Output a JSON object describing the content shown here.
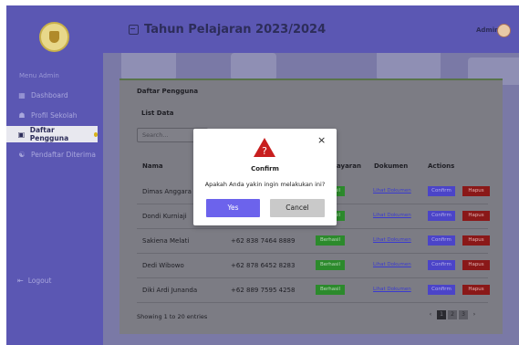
{
  "sidebar": {
    "menu_title": "Menu Admin",
    "items": [
      {
        "icon": "dashboard-icon",
        "label": "Dashboard"
      },
      {
        "icon": "school-icon",
        "label": "Profil Sekolah"
      },
      {
        "icon": "user-list-icon",
        "label": "Daftar Pengguna"
      },
      {
        "icon": "users-accepted-icon",
        "label": "Pendaftar Diterima"
      }
    ],
    "logout": "Logout"
  },
  "header": {
    "title": "Tahun Pelajaran 2023/2024",
    "admin": "Admin"
  },
  "card": {
    "title": "Daftar Pengguna",
    "list_label": "List Data",
    "search_placeholder": "Search...",
    "columns": [
      "Nama",
      "",
      "Pembayaran",
      "Dokumen",
      "Actions"
    ],
    "column_visible": [
      "Nama",
      "ayaran",
      "Dokumen",
      "Actions"
    ],
    "rows": [
      {
        "name": "Dimas Anggara",
        "phone": "",
        "status": "Berhasil",
        "doc": "Lihat Dokumen",
        "confirm": "Confirm",
        "delete": "Hapus"
      },
      {
        "name": "Dondi Kurniaji",
        "phone": "",
        "status": "Berhasil",
        "doc": "Lihat Dokumen",
        "confirm": "Confirm",
        "delete": "Hapus"
      },
      {
        "name": "Sakiena Melati",
        "phone": "+62 838 7464 8889",
        "status": "Berhasil",
        "doc": "Lihat Dokumen",
        "confirm": "Confirm",
        "delete": "Hapus"
      },
      {
        "name": "Dedi Wibowo",
        "phone": "+62 878 6452 8283",
        "status": "Berhasil",
        "doc": "Lihat Dokumen",
        "confirm": "Confirm",
        "delete": "Hapus"
      },
      {
        "name": "Diki Ardi Junanda",
        "phone": "+62 889 7595 4258",
        "status": "Berhasil",
        "doc": "Lihat Dokumen",
        "confirm": "Confirm",
        "delete": "Hapus"
      }
    ],
    "footer": "Showing 1 to 20 entries",
    "pager": {
      "prev": "‹",
      "pages": [
        "1",
        "2",
        "3"
      ],
      "next": "›"
    }
  },
  "modal": {
    "title": "Confirm",
    "message": "Apakah Anda yakin ingin melakukan ini?",
    "yes": "Yes",
    "cancel": "Cancel",
    "close": "×"
  },
  "colors": {
    "sidebar": "#5b57b3",
    "yes_button": "#6c63ec",
    "warning": "#c81e1e",
    "status_ok": "#2c8a2c"
  }
}
